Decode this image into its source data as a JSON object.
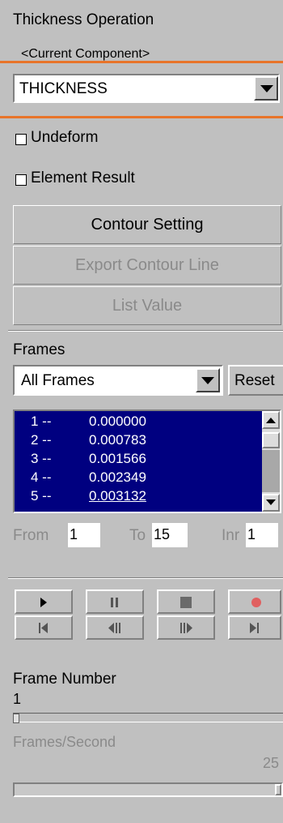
{
  "panel": {
    "title": "Thickness Operation",
    "current_component_label": "<Current Component>",
    "component_dropdown": {
      "value": "THICKNESS"
    }
  },
  "options": {
    "undeform_label": "Undeform",
    "undeform_checked": false,
    "element_result_label": "Element Result",
    "element_result_checked": false
  },
  "buttons": {
    "contour_setting": "Contour Setting",
    "export_contour_line": "Export Contour Line",
    "list_value": "List Value"
  },
  "frames": {
    "heading": "Frames",
    "range_dropdown": "All Frames",
    "reset_label": "Reset",
    "list": [
      {
        "index": "1 --",
        "value": "0.000000"
      },
      {
        "index": "2 --",
        "value": "0.000783"
      },
      {
        "index": "3 --",
        "value": "0.001566"
      },
      {
        "index": "4 --",
        "value": "0.002349"
      },
      {
        "index": "5 --",
        "value": "0.003132"
      }
    ],
    "from_label": "From",
    "from_value": "1",
    "to_label": "To",
    "to_value": "15",
    "inr_label": "Inr",
    "inr_value": "1"
  },
  "playback": {
    "play_icon": "play-icon",
    "pause_icon": "pause-icon",
    "stop_icon": "stop-icon",
    "record_icon": "record-icon",
    "first_icon": "skip-to-first-icon",
    "step_back_icon": "step-backward-icon",
    "step_forward_icon": "step-forward-icon",
    "last_icon": "skip-to-last-icon",
    "record_color": "#e06060"
  },
  "frame_number": {
    "label": "Frame Number",
    "value": "1"
  },
  "fps": {
    "label": "Frames/Second",
    "value": "25"
  },
  "colors": {
    "panel_bg": "#c0c0c0",
    "list_bg": "#000080",
    "annotation_line": "#e8742a"
  }
}
